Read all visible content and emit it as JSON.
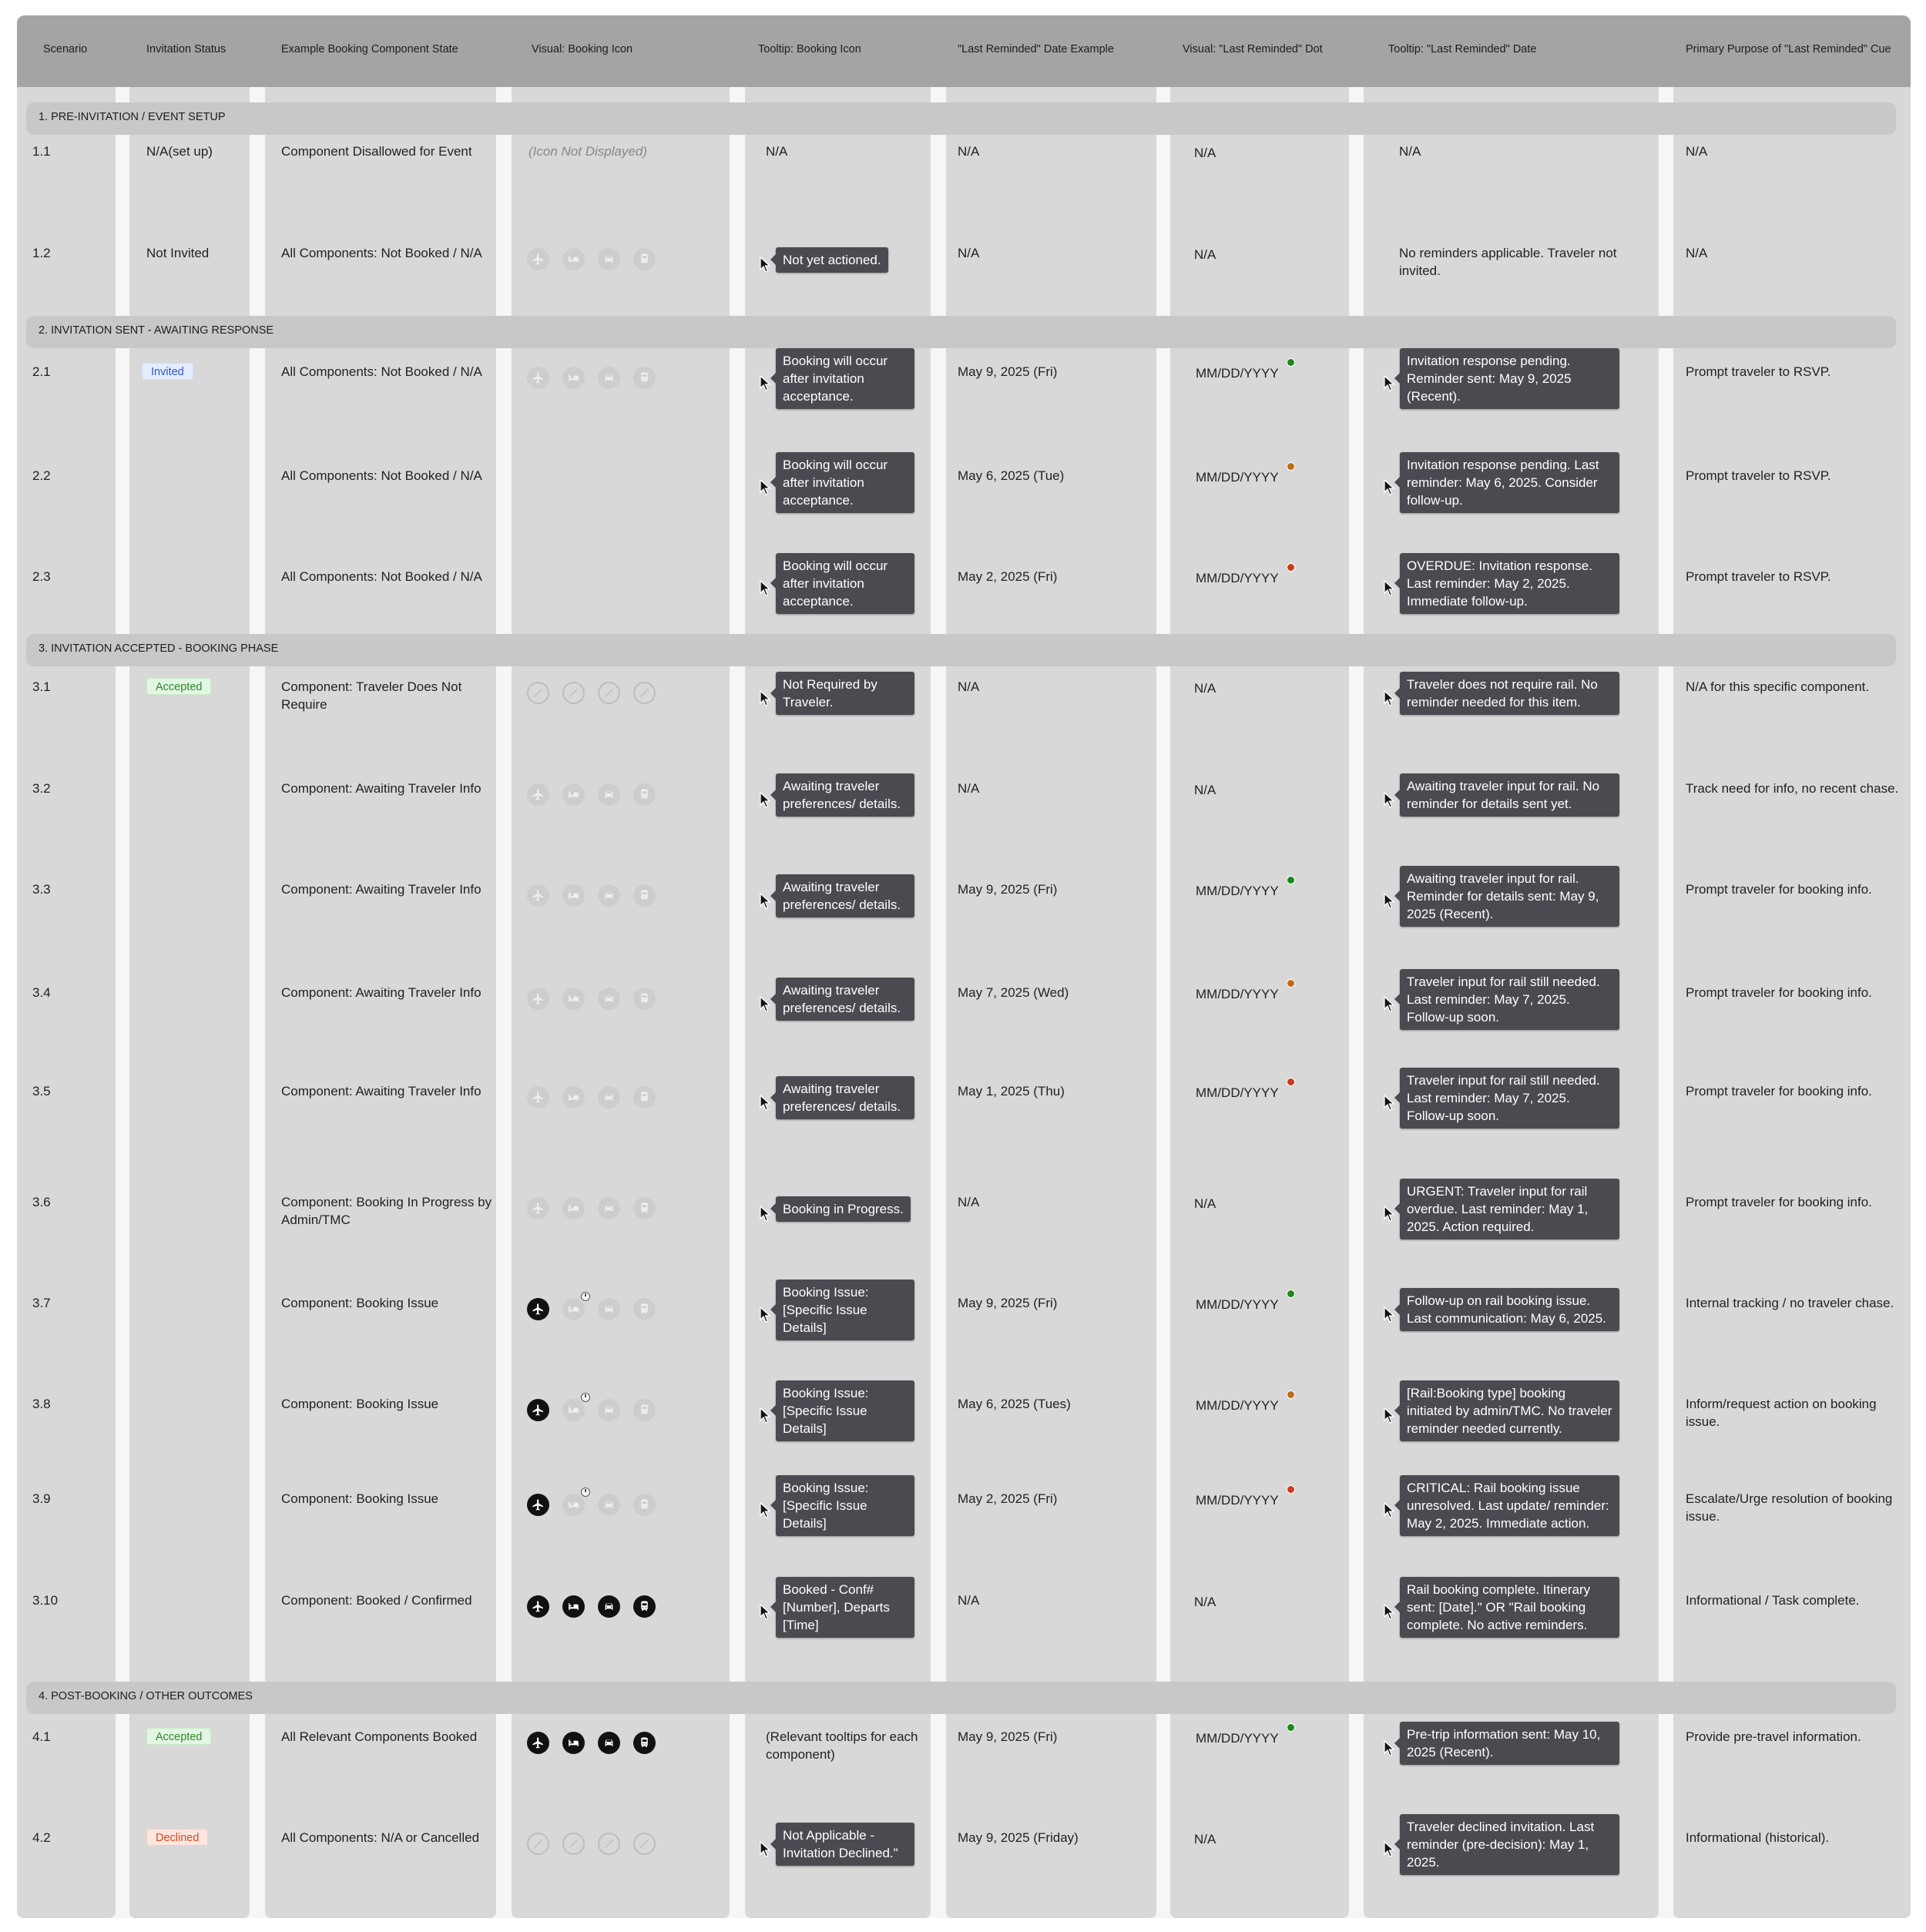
{
  "header": {
    "scenario": "Scenario",
    "invitation_status": "Invitation Status",
    "component_state": "Example Booking Component State",
    "visual_icon": "Visual: Booking Icon",
    "tooltip_icon": "Tooltip: Booking Icon",
    "last_reminded_example": "\"Last Reminded\" Date Example",
    "visual_dot": "Visual: \"Last Reminded\" Dot",
    "tooltip_date": "Tooltip: \"Last Reminded\" Date",
    "primary_purpose": "Primary Purpose of \"Last Reminded\" Cue"
  },
  "colors": {
    "dot_green": "#1a8a1a",
    "dot_orange": "#c06a16",
    "dot_red": "#d0381c",
    "tooltip_bg": "#4a4b50",
    "header_bg": "#a4a4a4"
  },
  "icon_set": [
    "airplane-icon",
    "hotel-bed-icon",
    "car-icon",
    "train-icon"
  ],
  "sections": [
    {
      "title": "1. PRE-INVITATION / EVENT SETUP",
      "rows": [
        {
          "id": "1.1",
          "status": "N/A(set up)",
          "status_badge": "",
          "state": "Component Disallowed for Event",
          "icon_style": "hidden",
          "icon_text": "(Icon Not Displayed)",
          "tip_icon": "N/A",
          "tip_icon_style": "plain",
          "date": "N/A",
          "dot_text": "N/A",
          "dot_color": "",
          "tip_date": "N/A",
          "tip_date_style": "plain",
          "purpose": "N/A"
        },
        {
          "id": "1.2",
          "status": "Not Invited",
          "status_badge": "",
          "state": "All Components: Not Booked / N/A",
          "icon_style": "faint",
          "icon_text": "",
          "tip_icon": "Not yet actioned.",
          "tip_icon_style": "tooltip",
          "date": "N/A",
          "dot_text": "N/A",
          "dot_color": "",
          "tip_date": "No reminders applicable. Traveler not invited.",
          "tip_date_style": "plain",
          "purpose": "N/A"
        }
      ]
    },
    {
      "title": "2. INVITATION SENT - AWAITING RESPONSE",
      "rows": [
        {
          "id": "2.1",
          "status": "Invited",
          "status_badge": "invited",
          "state": "All Components: Not Booked / N/A",
          "icon_style": "faint",
          "icon_text": "",
          "tip_icon": "Booking will occur after invitation acceptance.",
          "tip_icon_style": "tooltip",
          "date": "May 9, 2025 (Fri)",
          "dot_text": "MM/DD/YYYY",
          "dot_color": "green",
          "tip_date": "Invitation response pending. Reminder sent: May 9, 2025 (Recent).",
          "tip_date_style": "tooltip",
          "purpose": "Prompt traveler to RSVP."
        },
        {
          "id": "2.2",
          "status": "",
          "status_badge": "",
          "state": "All Components: Not Booked / N/A",
          "icon_style": "none",
          "icon_text": "",
          "tip_icon": "Booking will occur after invitation acceptance.",
          "tip_icon_style": "tooltip",
          "date": "May 6, 2025 (Tue)",
          "dot_text": "MM/DD/YYYY",
          "dot_color": "orange",
          "tip_date": "Invitation response pending. Last reminder: May 6, 2025. Consider follow-up.",
          "tip_date_style": "tooltip",
          "purpose": "Prompt traveler to RSVP."
        },
        {
          "id": "2.3",
          "status": "",
          "status_badge": "",
          "state": "All Components: Not Booked / N/A",
          "icon_style": "none",
          "icon_text": "",
          "tip_icon": "Booking will occur after invitation acceptance.",
          "tip_icon_style": "tooltip",
          "date": "May 2, 2025 (Fri)",
          "dot_text": "MM/DD/YYYY",
          "dot_color": "red",
          "tip_date": "OVERDUE: Invitation response. Last reminder: May 2, 2025. Immediate follow-up.",
          "tip_date_style": "tooltip",
          "purpose": "Prompt traveler to RSVP."
        }
      ]
    },
    {
      "title": "3. INVITATION ACCEPTED - BOOKING PHASE",
      "rows": [
        {
          "id": "3.1",
          "status": "Accepted",
          "status_badge": "accepted",
          "state": "Component: Traveler Does Not Require",
          "icon_style": "off",
          "icon_text": "",
          "tip_icon": "Not Required by Traveler.",
          "tip_icon_style": "tooltip",
          "date": "N/A",
          "dot_text": "N/A",
          "dot_color": "",
          "tip_date": "Traveler does not require rail. No reminder needed for this item.",
          "tip_date_style": "tooltip",
          "purpose": "N/A for this specific component."
        },
        {
          "id": "3.2",
          "status": "",
          "status_badge": "",
          "state": "Component: Awaiting Traveler Info",
          "icon_style": "faint",
          "icon_text": "",
          "tip_icon": "Awaiting traveler preferences/ details.",
          "tip_icon_style": "tooltip",
          "date": "N/A",
          "dot_text": "N/A",
          "dot_color": "",
          "tip_date": "Awaiting traveler input for rail. No reminder for details sent yet.",
          "tip_date_style": "tooltip",
          "purpose": "Track need for info, no recent chase."
        },
        {
          "id": "3.3",
          "status": "",
          "status_badge": "",
          "state": "Component: Awaiting Traveler Info",
          "icon_style": "faint",
          "icon_text": "",
          "tip_icon": "Awaiting traveler preferences/ details.",
          "tip_icon_style": "tooltip",
          "date": "May 9, 2025 (Fri)",
          "dot_text": "MM/DD/YYYY",
          "dot_color": "green",
          "tip_date": "Awaiting traveler input for rail. Reminder for details sent: May 9, 2025 (Recent).",
          "tip_date_style": "tooltip",
          "purpose": "Prompt traveler for booking info."
        },
        {
          "id": "3.4",
          "status": "",
          "status_badge": "",
          "state": "Component: Awaiting Traveler Info",
          "icon_style": "faint",
          "icon_text": "",
          "tip_icon": "Awaiting traveler preferences/ details.",
          "tip_icon_style": "tooltip",
          "date": "May 7, 2025 (Wed)",
          "dot_text": "MM/DD/YYYY",
          "dot_color": "orange",
          "tip_date": "Traveler input for rail still needed. Last reminder: May 7, 2025. Follow-up soon.",
          "tip_date_style": "tooltip",
          "purpose": "Prompt traveler for booking info."
        },
        {
          "id": "3.5",
          "status": "",
          "status_badge": "",
          "state": "Component: Awaiting Traveler Info",
          "icon_style": "faint",
          "icon_text": "",
          "tip_icon": "Awaiting traveler preferences/ details.",
          "tip_icon_style": "tooltip",
          "date": "May 1, 2025 (Thu)",
          "dot_text": "MM/DD/YYYY",
          "dot_color": "red",
          "tip_date": "Traveler input for rail still needed. Last reminder: May 7, 2025. Follow-up soon.",
          "tip_date_style": "tooltip",
          "purpose": "Prompt traveler for booking info."
        },
        {
          "id": "3.6",
          "status": "",
          "status_badge": "",
          "state": "Component: Booking In Progress by Admin/TMC",
          "icon_style": "faint",
          "icon_text": "",
          "tip_icon": "Booking in Progress.",
          "tip_icon_style": "tooltip",
          "date": "N/A",
          "dot_text": "N/A",
          "dot_color": "",
          "tip_date": "URGENT: Traveler input for rail overdue. Last reminder: May 1, 2025. Action required.",
          "tip_date_style": "tooltip",
          "purpose": "Prompt traveler for booking info."
        },
        {
          "id": "3.7",
          "status": "",
          "status_badge": "",
          "state": "Component: Booking Issue",
          "icon_style": "issue",
          "icon_text": "",
          "tip_icon": "Booking Issue: [Specific Issue Details]",
          "tip_icon_style": "tooltip",
          "date": "May 9, 2025 (Fri)",
          "dot_text": "MM/DD/YYYY",
          "dot_color": "green",
          "tip_date": "Follow-up on rail booking issue. Last communication: May 6, 2025.",
          "tip_date_style": "tooltip",
          "purpose": "Internal tracking / no traveler chase."
        },
        {
          "id": "3.8",
          "status": "",
          "status_badge": "",
          "state": "Component: Booking Issue",
          "icon_style": "issue",
          "icon_text": "",
          "tip_icon": "Booking Issue: [Specific Issue Details]",
          "tip_icon_style": "tooltip",
          "date": "May 6, 2025 (Tues)",
          "dot_text": "MM/DD/YYYY",
          "dot_color": "orange",
          "tip_date": "[Rail:Booking type] booking initiated by admin/TMC. No traveler reminder needed currently.",
          "tip_date_style": "tooltip",
          "purpose": "Inform/request action on booking issue."
        },
        {
          "id": "3.9",
          "status": "",
          "status_badge": "",
          "state": "Component: Booking Issue",
          "icon_style": "issue",
          "icon_text": "",
          "tip_icon": "Booking Issue: [Specific Issue Details]",
          "tip_icon_style": "tooltip",
          "date": "May 2, 2025 (Fri)",
          "dot_text": "MM/DD/YYYY",
          "dot_color": "red",
          "tip_date": "CRITICAL: Rail booking issue unresolved. Last update/ reminder: May 2, 2025. Immediate action.",
          "tip_date_style": "tooltip",
          "purpose": "Escalate/Urge resolution of booking issue."
        },
        {
          "id": "3.10",
          "status": "",
          "status_badge": "",
          "state": "Component: Booked / Confirmed",
          "icon_style": "solid",
          "icon_text": "",
          "tip_icon": "Booked - Conf# [Number], Departs [Time]",
          "tip_icon_style": "tooltip",
          "date": "N/A",
          "dot_text": "N/A",
          "dot_color": "",
          "tip_date": "Rail booking complete. Itinerary sent: [Date].\" OR \"Rail booking complete. No active reminders.",
          "tip_date_style": "tooltip",
          "purpose": "Informational / Task complete."
        }
      ]
    },
    {
      "title": "4. POST-BOOKING / OTHER OUTCOMES",
      "rows": [
        {
          "id": "4.1",
          "status": "Accepted",
          "status_badge": "accepted",
          "state": "All Relevant Components Booked",
          "icon_style": "solid",
          "icon_text": "",
          "tip_icon": "(Relevant tooltips for each component)",
          "tip_icon_style": "plain",
          "date": "May 9, 2025 (Fri)",
          "dot_text": "MM/DD/YYYY",
          "dot_color": "green",
          "tip_date": "Pre-trip information sent: May 10, 2025 (Recent).",
          "tip_date_style": "tooltip",
          "purpose": "Provide pre-travel information."
        },
        {
          "id": "4.2",
          "status": "Declined",
          "status_badge": "declined",
          "state": "All Components: N/A or Cancelled",
          "icon_style": "off",
          "icon_text": "",
          "tip_icon": "Not Applicable - Invitation Declined.\"",
          "tip_icon_style": "tooltip",
          "date": "May 9, 2025 (Friday)",
          "dot_text": "N/A",
          "dot_color": "",
          "tip_date": "Traveler declined invitation. Last reminder (pre-decision): May 1, 2025.",
          "tip_date_style": "tooltip",
          "purpose": "Informational (historical)."
        }
      ]
    }
  ]
}
